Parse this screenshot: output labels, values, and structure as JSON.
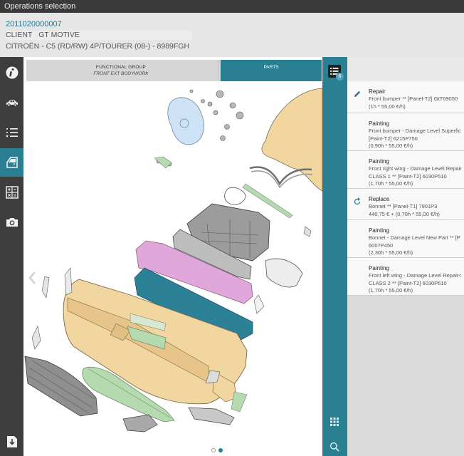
{
  "window": {
    "title": "Operations selection"
  },
  "header": {
    "claim_number": "2011020000007",
    "client_label": "CLIENT",
    "client_name": "GT MOTIVE",
    "vehicle": "CITROËN - C5 (RD/RW) 4P/TOURER (08-) - 8989FGH"
  },
  "sidebar": {
    "items": [
      {
        "name": "info-icon"
      },
      {
        "name": "car-icon"
      },
      {
        "name": "checklist-icon"
      },
      {
        "name": "door-icon",
        "active": true
      },
      {
        "name": "calculator-icon"
      },
      {
        "name": "camera-icon"
      },
      {
        "name": "download-icon"
      }
    ]
  },
  "center": {
    "functional_group_label": "FUNCTIONAL GROUP",
    "functional_group_value": "FRONT EXT BODYWORK",
    "parts_tab_label": "PARTS",
    "pager": {
      "pages": 2,
      "current": 2
    }
  },
  "operations_badge": "6",
  "operations": [
    {
      "icon": "pencil-icon",
      "type": "Repair",
      "lines": [
        "Front bumper ** [Panel-T2] GtT69050",
        "(1h * 55,00 €/h)"
      ]
    },
    {
      "icon": "",
      "type": "Painting",
      "lines": [
        "Front bumper - Damage Level Superfic",
        "[Paint-T2] 6215P750",
        "(0,90h * 55,00 €/h)"
      ]
    },
    {
      "icon": "",
      "type": "Painting",
      "lines": [
        "Front right wing - Damage Level Repair",
        "CLASS 1 ** [Paint-T2] 6030P510",
        "(1,70h * 55,00 €/h)"
      ]
    },
    {
      "icon": "replace-icon",
      "type": "Replace",
      "lines": [
        "Bonnet ** [Panel-T1] 7901P3",
        "440,75 € + (0,70h * 55,00 €/h)"
      ]
    },
    {
      "icon": "",
      "type": "Painting",
      "lines": [
        "Bonnet - Damage Level New Part ** [P",
        "6007P450",
        "(2,30h * 55,00 €/h)"
      ]
    },
    {
      "icon": "",
      "type": "Painting",
      "lines": [
        "Front left wing - Damage Level Repair<",
        "CLASS 2 ** [Paint-T2] 6030P610",
        "(1,70h * 55,00 €/h)"
      ]
    }
  ],
  "colors": {
    "accent": "#2b7f93",
    "sidebar": "#3d3d3d",
    "titlebar": "#3a3a3a",
    "part_selected_yellow": "#f1d6a0",
    "part_selected_pink": "#e0a7da",
    "part_selected_teal": "#2d8196",
    "part_selected_green": "#b6dab0",
    "part_selected_blue": "#cde2f4"
  }
}
